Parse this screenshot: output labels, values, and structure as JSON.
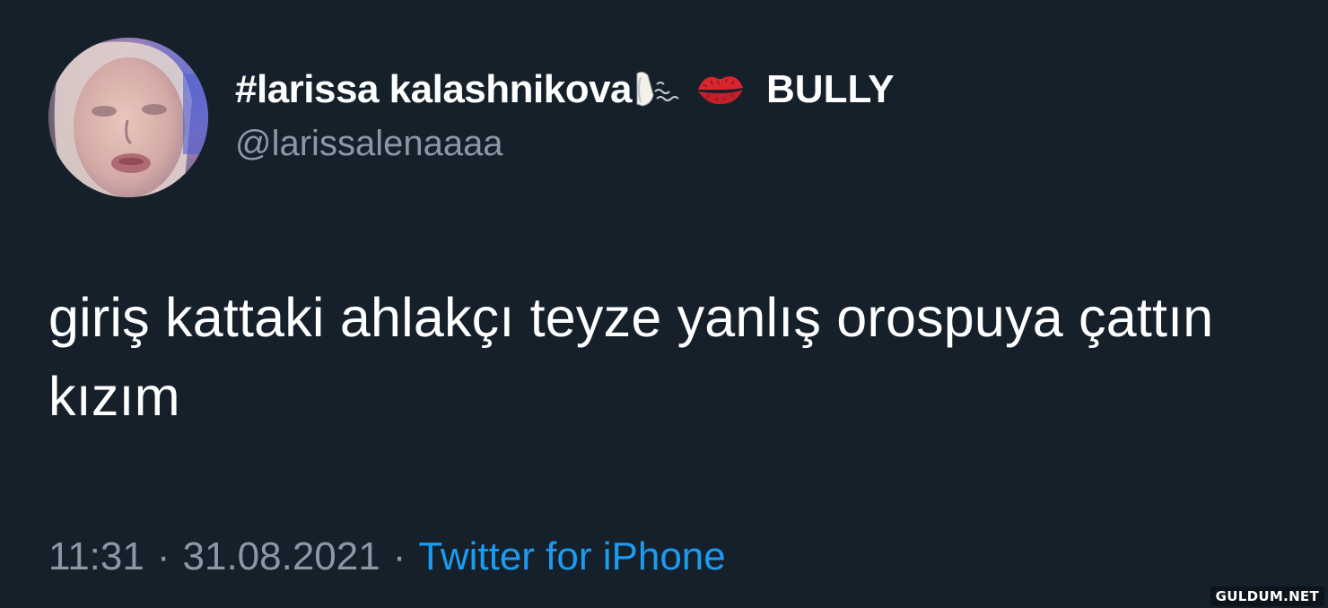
{
  "tweet": {
    "display_name": "#larissa kalashnikova",
    "name_suffix": "BULLY",
    "name_emojis": [
      "nose-steam-emoji",
      "kiss-mark-emoji"
    ],
    "handle": "@larissalenaaaa",
    "text": "giriş kattaki ahlakçı teyze yanlış orospuya çattın kızım",
    "time": "11:31",
    "date": "31.08.2021",
    "separator": "·",
    "source": "Twitter for iPhone"
  },
  "watermark": "GULDUM.NET",
  "colors": {
    "background": "#15202b",
    "primary_text": "#ffffff",
    "secondary_text": "#8b98a5",
    "link": "#1d9bf0",
    "kiss": "#d8262e"
  }
}
